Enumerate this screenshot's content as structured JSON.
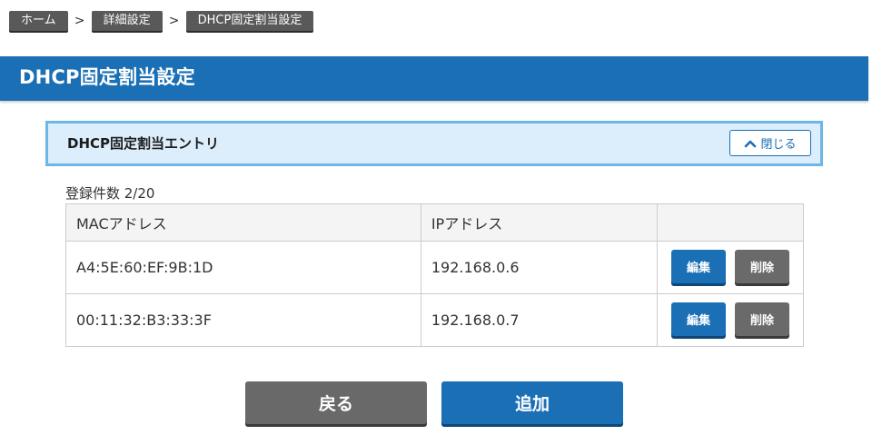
{
  "breadcrumb": {
    "items": [
      "ホーム",
      "詳細設定",
      "DHCP固定割当設定"
    ],
    "separator": ">"
  },
  "page_title": "DHCP固定割当設定",
  "section": {
    "title": "DHCP固定割当エントリ",
    "close_label": "閉じる",
    "close_icon": "chevron-up-icon"
  },
  "count_label": "登録件数 2/20",
  "table": {
    "headers": [
      "MACアドレス",
      "IPアドレス",
      ""
    ],
    "rows": [
      {
        "mac": "A4:5E:60:EF:9B:1D",
        "ip": "192.168.0.6",
        "edit_label": "編集",
        "delete_label": "削除"
      },
      {
        "mac": "00:11:32:B3:33:3F",
        "ip": "192.168.0.7",
        "edit_label": "編集",
        "delete_label": "削除"
      }
    ]
  },
  "buttons": {
    "back_label": "戻る",
    "add_label": "追加"
  },
  "colors": {
    "primary": "#1a6fb5",
    "secondary": "#696969",
    "section_bg": "#dcedfb",
    "section_border": "#6db6e6"
  }
}
